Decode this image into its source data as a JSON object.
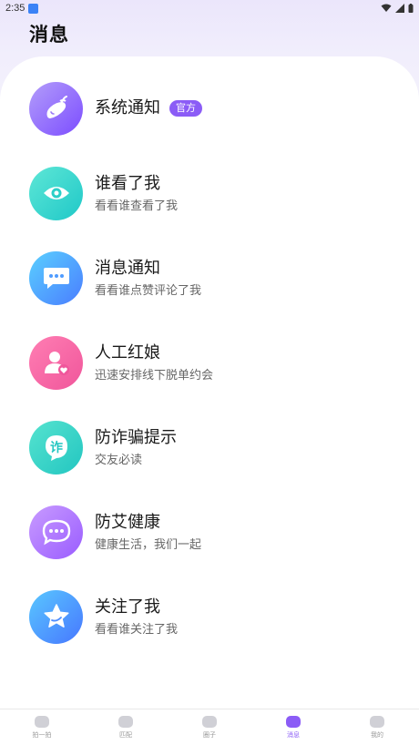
{
  "status_bar": {
    "time": "2:35"
  },
  "header": {
    "title": "消息"
  },
  "messages": [
    {
      "title": "系统通知",
      "badge": "官方",
      "subtitle": "",
      "icon": "eggplant-icon",
      "gradient": [
        "#b39dfa",
        "#7c4dff"
      ]
    },
    {
      "title": "谁看了我",
      "subtitle": "看看谁查看了我",
      "icon": "eye-icon",
      "gradient": [
        "#5ee7d6",
        "#1fc8c8"
      ]
    },
    {
      "title": "消息通知",
      "subtitle": "看看谁点赞评论了我",
      "icon": "chat-bubble-icon",
      "gradient": [
        "#5ad0ff",
        "#4a7dff"
      ]
    },
    {
      "title": "人工红娘",
      "subtitle": "迅速安排线下脱单约会",
      "icon": "person-heart-icon",
      "gradient": [
        "#ff7eb3",
        "#f0569b"
      ]
    },
    {
      "title": "防诈骗提示",
      "subtitle": "交友必读",
      "icon": "fraud-alert-icon",
      "gradient": [
        "#55e3cf",
        "#23c6c1"
      ]
    },
    {
      "title": "防艾健康",
      "subtitle": "健康生活，我们一起",
      "icon": "chat-dots-icon",
      "gradient": [
        "#c89bff",
        "#9a5cff"
      ]
    },
    {
      "title": "关注了我",
      "subtitle": "看看谁关注了我",
      "icon": "star-icon",
      "gradient": [
        "#59c7ff",
        "#4777ff"
      ]
    }
  ],
  "bottom_nav": [
    {
      "label": "拍一拍",
      "icon": "tap-icon",
      "active": false
    },
    {
      "label": "匹配",
      "icon": "match-icon",
      "active": false
    },
    {
      "label": "圈子",
      "icon": "circle-icon",
      "active": false
    },
    {
      "label": "消息",
      "icon": "message-icon",
      "active": true
    },
    {
      "label": "我的",
      "icon": "profile-icon",
      "active": false
    }
  ],
  "colors": {
    "accent": "#8b5cf6"
  }
}
